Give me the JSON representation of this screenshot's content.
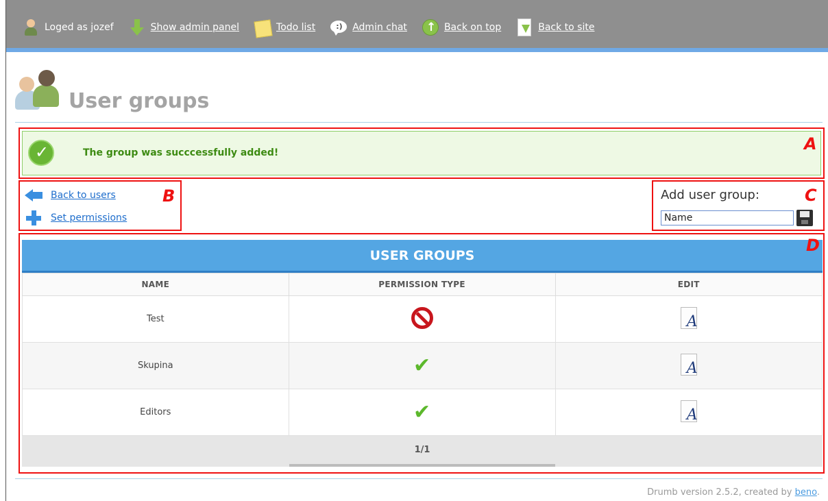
{
  "topbar": {
    "logged_as": "Loged as jozef",
    "links": {
      "admin_panel": "Show admin panel",
      "todo": "Todo list",
      "chat": "Admin chat",
      "top": "Back on top",
      "site": "Back to site"
    }
  },
  "page": {
    "title": "User groups"
  },
  "message": {
    "text": "The group was succcessfully added!"
  },
  "actions": {
    "back": "Back to users",
    "permissions": "Set permissions"
  },
  "add_group": {
    "label": "Add user group:",
    "input_value": "Name"
  },
  "table": {
    "title": "USER GROUPS",
    "headers": [
      "NAME",
      "PERMISSION TYPE",
      "EDIT"
    ],
    "rows": [
      {
        "name": "Test",
        "permission": "forbidden-icon"
      },
      {
        "name": "Skupina",
        "permission": "check-icon"
      },
      {
        "name": "Editors",
        "permission": "check-icon"
      }
    ],
    "pagination": "1/1"
  },
  "annotations": {
    "a": "A",
    "b": "B",
    "c": "C",
    "d": "D"
  },
  "footer": {
    "text": "Drumb version 2.5.2, created by ",
    "author": "beno",
    "end": "."
  },
  "colors": {
    "accent": "#54a6e3",
    "success": "#3d8b12",
    "annotation": "#e11111",
    "topbar": "#8f8f8f"
  }
}
